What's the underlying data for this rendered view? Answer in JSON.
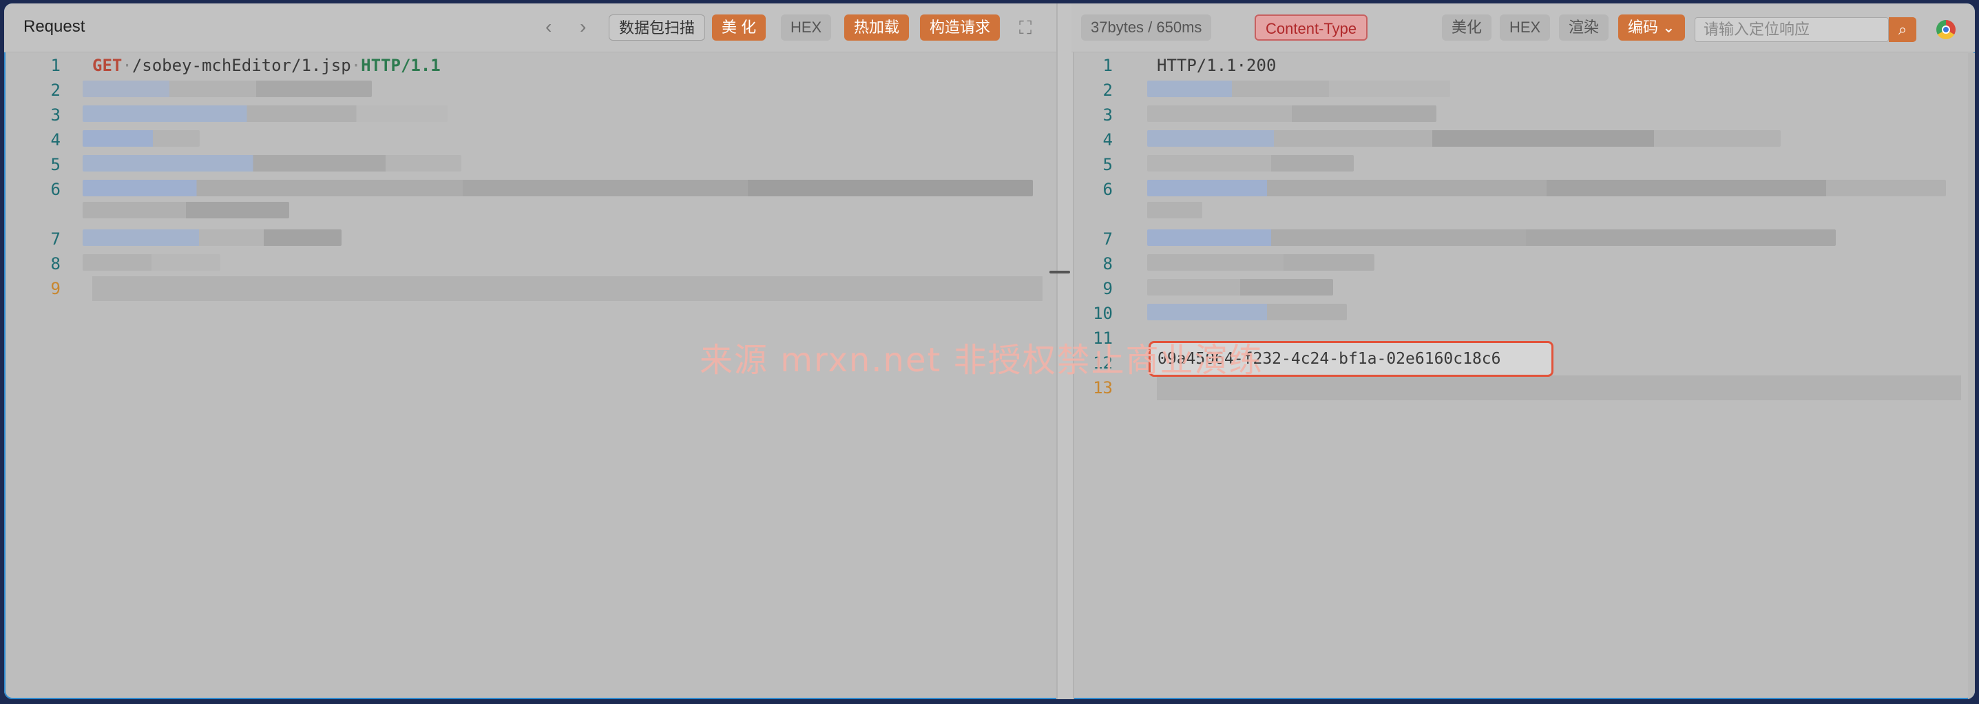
{
  "request": {
    "title": "Request",
    "buttons": {
      "scan": "数据包扫描",
      "beautify": "美 化",
      "hex": "HEX",
      "hot_load": "热加载",
      "construct": "构造请求"
    },
    "lines": [
      "1",
      "2",
      "3",
      "4",
      "5",
      "6",
      "7",
      "8",
      "9"
    ],
    "first_line": {
      "method": "GET",
      "path": "/sobey-mchEditor/1.jsp",
      "proto": "HTTP/1.1"
    }
  },
  "response": {
    "stats": "37bytes / 650ms",
    "content_type": "Content-Type",
    "buttons": {
      "beautify": "美化",
      "hex": "HEX",
      "render": "渲染",
      "encode": "编码"
    },
    "search_placeholder": "请输入定位响应",
    "lines": [
      "1",
      "2",
      "3",
      "4",
      "5",
      "6",
      "7",
      "8",
      "9",
      "10",
      "11",
      "12",
      "13"
    ],
    "status_line": "HTTP/1.1·200",
    "body_value": "09a45064-f232-4c24-bf1a-02e6160c18c6"
  },
  "watermark": "来源 mrxn.net 非授权禁止商业演练",
  "icons": {
    "prev": "chevron-left-icon",
    "next": "chevron-right-icon",
    "fullscreen": "expand-icon",
    "search": "search-icon",
    "browser": "chrome-icon"
  }
}
